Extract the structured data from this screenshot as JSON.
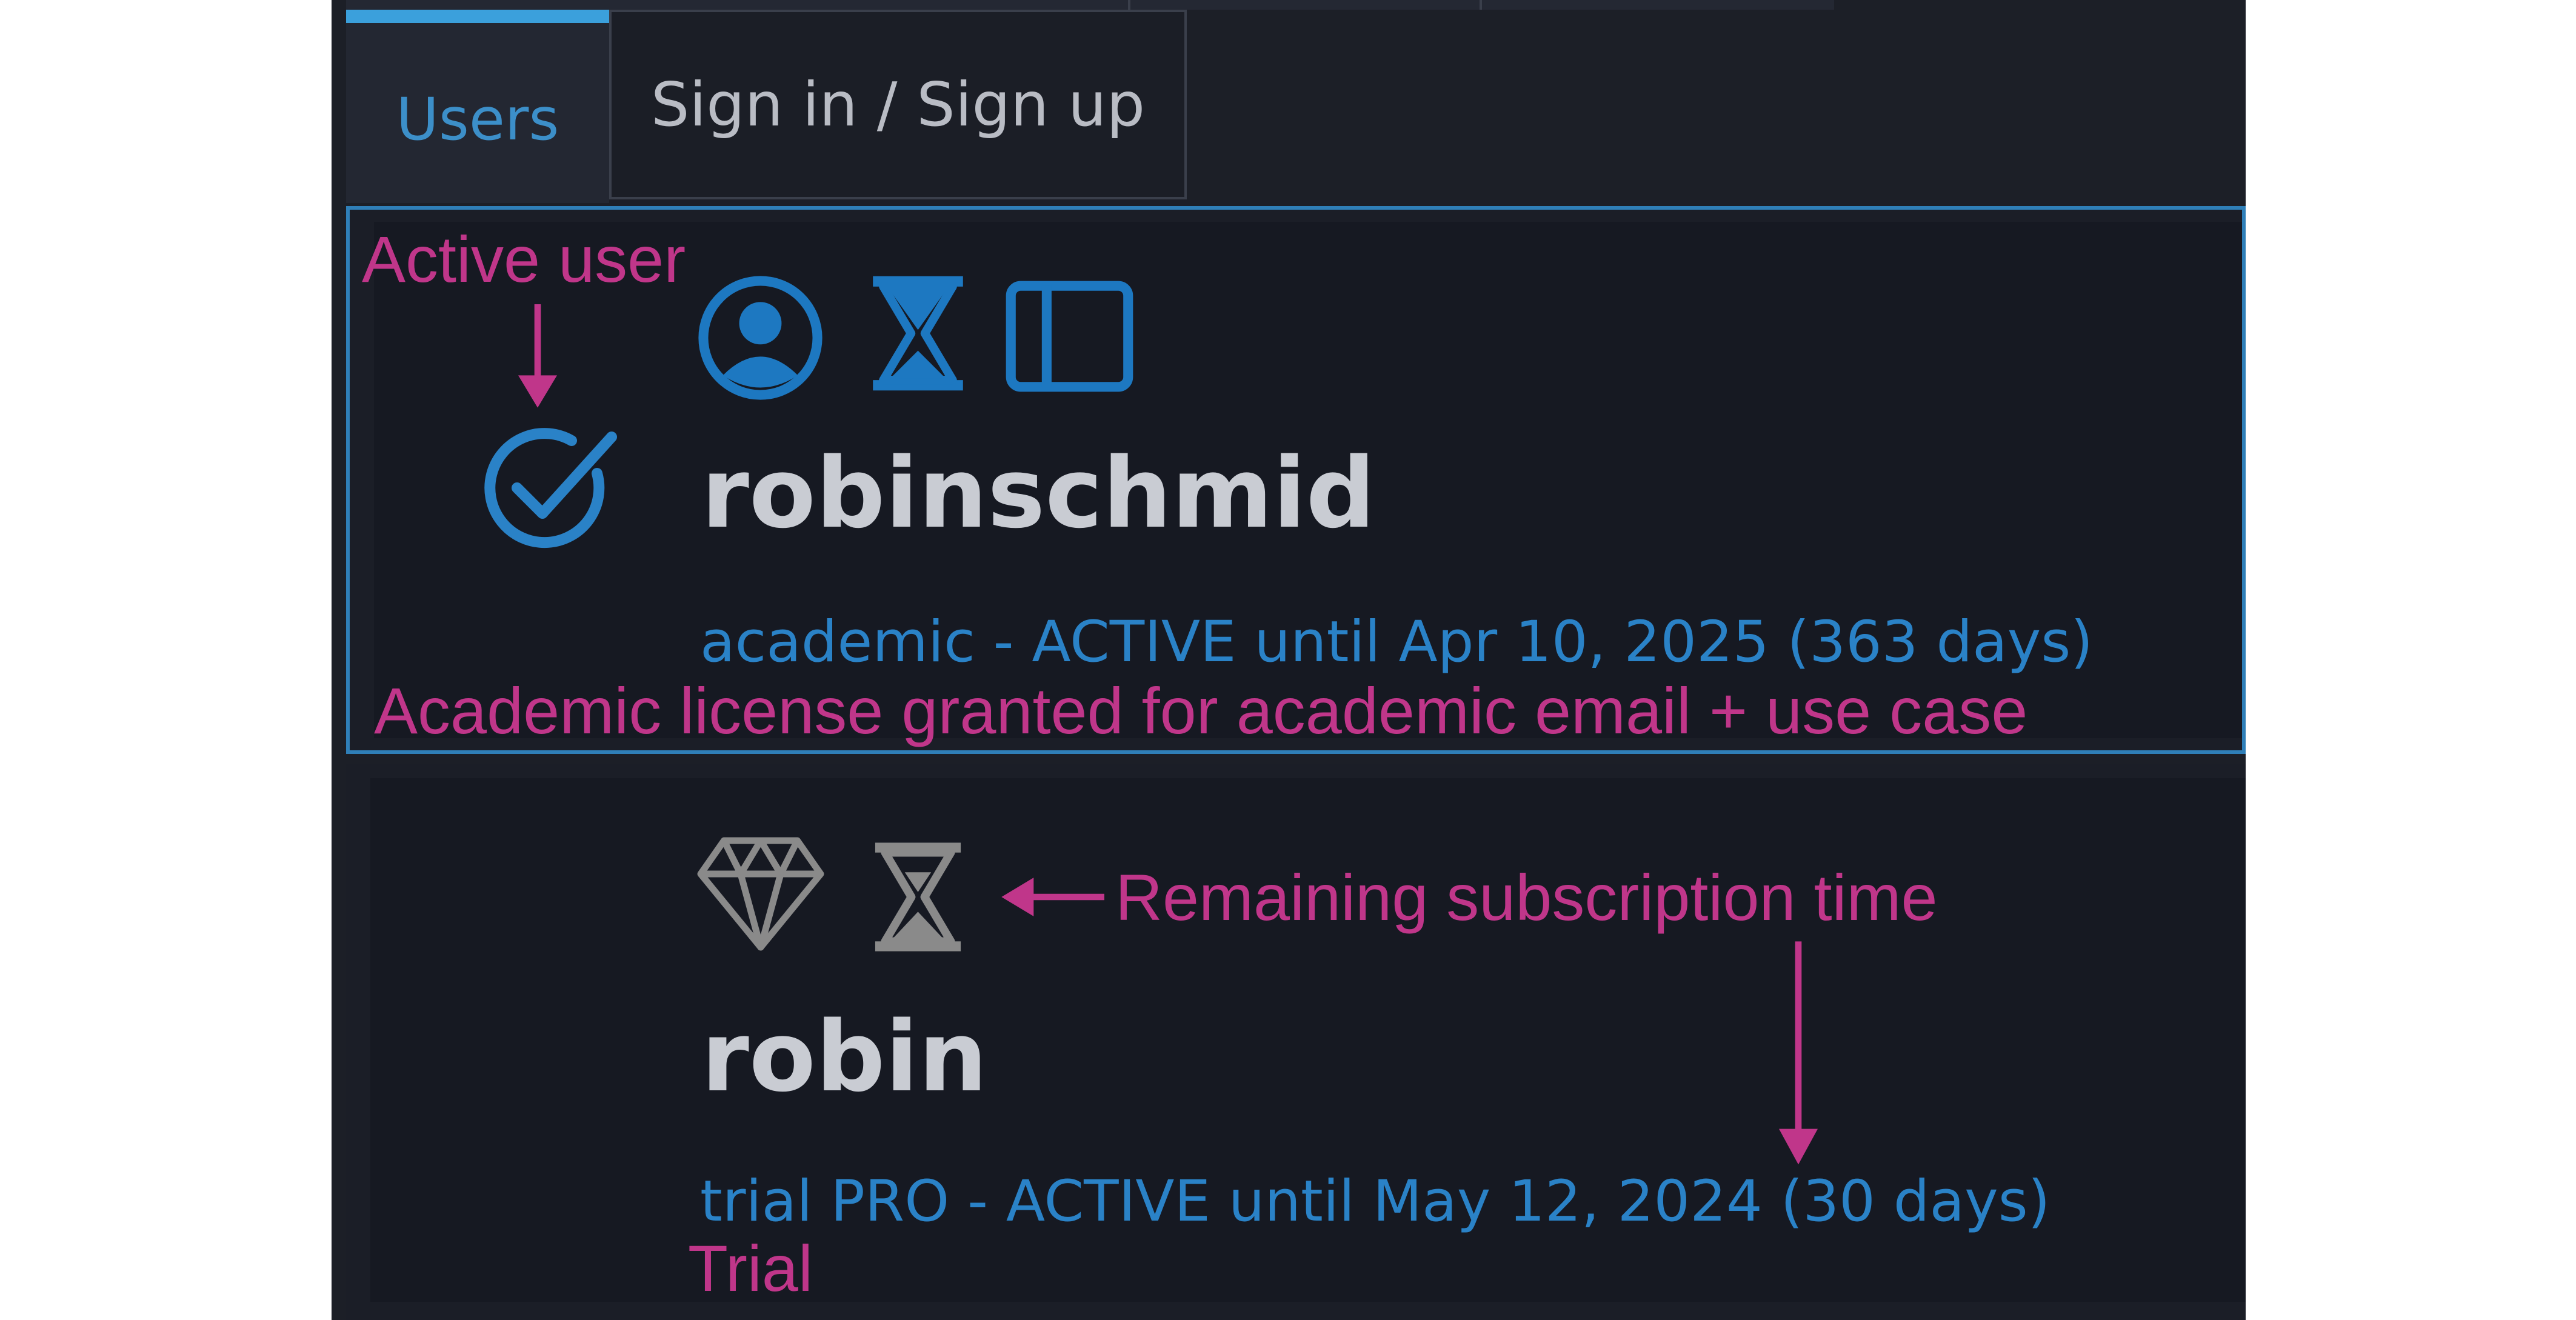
{
  "tabs": [
    {
      "label": "Users",
      "active": true
    },
    {
      "label": "Sign in / Sign up",
      "active": false
    }
  ],
  "users": [
    {
      "username": "robinschmid",
      "license": "academic - ACTIVE until Apr 10, 2025 (363 days)",
      "active": true,
      "icons": [
        "user-circle-icon",
        "hourglass-icon",
        "sidebar-panel-icon"
      ]
    },
    {
      "username": "robin",
      "license": "trial PRO - ACTIVE until May 12, 2024 (30 days)",
      "active": false,
      "icons": [
        "diamond-icon",
        "hourglass-icon"
      ]
    }
  ],
  "annotations": {
    "active_user": "Active user",
    "academic_note": "Academic license granted for academic email + use case",
    "remaining_time": "Remaining subscription time",
    "trial": "Trial"
  },
  "colors": {
    "accent_blue": "#2a82c7",
    "annotation_magenta": "#c0368a",
    "panel_bg": "#1c1f27",
    "inactive_icon": "#8a8a8a"
  }
}
